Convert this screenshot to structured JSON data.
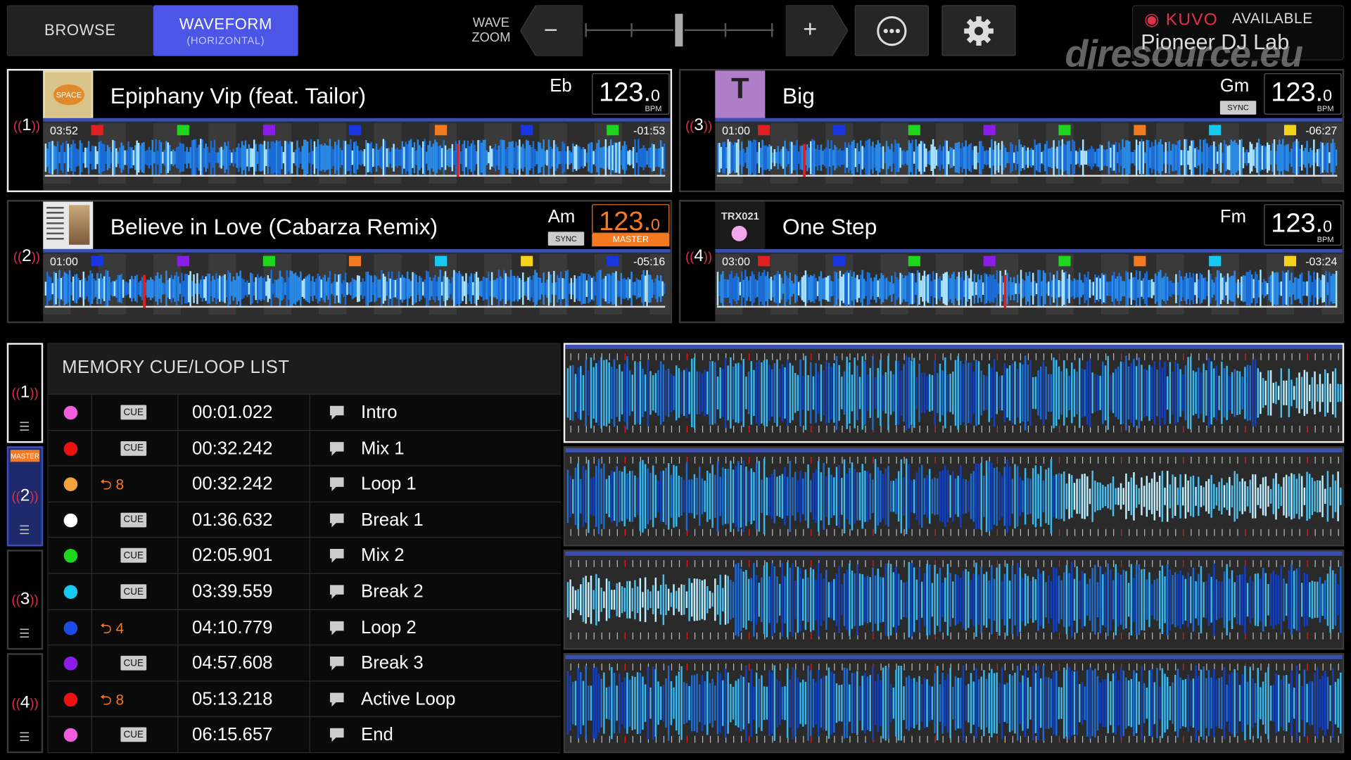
{
  "top_bar": {
    "browse_label": "BROWSE",
    "waveform_label": "WAVEFORM",
    "waveform_sub": "(HORIZONTAL)",
    "wave_zoom_line1": "WAVE",
    "wave_zoom_line2": "ZOOM",
    "zoom_out_symbol": "−",
    "zoom_in_symbol": "+",
    "zoom_level": 0.5,
    "more_icon": "more-icon",
    "settings_icon": "gear-icon"
  },
  "kuvo": {
    "logo": "KUVO",
    "status": "AVAILABLE",
    "name": "Pioneer DJ Lab"
  },
  "watermark": "djresource.eu",
  "decks": [
    {
      "number": "1",
      "title": "Epiphany Vip (feat. Tailor)",
      "key": "Eb",
      "bpm_int": "123.",
      "bpm_dec": "0",
      "bpm_unit": "BPM",
      "elapsed": "03:52",
      "remaining": "-01:53",
      "sync_label": "",
      "master_label": "",
      "active": true,
      "art_label": "SPACE",
      "hot_cues": [
        "A",
        "C",
        "D",
        "B",
        "F",
        "B",
        "E"
      ]
    },
    {
      "number": "2",
      "title": "Believe in Love (Cabarza Remix)",
      "key": "Am",
      "bpm_int": "123.",
      "bpm_dec": "0",
      "bpm_unit": "MASTER",
      "elapsed": "01:00",
      "remaining": "-05:16",
      "sync_label": "SYNC",
      "master_label": "MASTER",
      "active": false,
      "art_label": "",
      "hot_cues": [
        "B",
        "D",
        "E",
        "F",
        "G",
        "H",
        "B"
      ]
    },
    {
      "number": "3",
      "title": "Big",
      "key": "Gm",
      "bpm_int": "123.",
      "bpm_dec": "0",
      "bpm_unit": "BPM",
      "elapsed": "01:00",
      "remaining": "-06:27",
      "sync_label": "SYNC",
      "master_label": "",
      "active": false,
      "art_label": "T",
      "hot_cues": [
        "A",
        "B",
        "C",
        "D",
        "E",
        "F",
        "G",
        "H"
      ]
    },
    {
      "number": "4",
      "title": "One Step",
      "key": "Fm",
      "bpm_int": "123.",
      "bpm_dec": "0",
      "bpm_unit": "BPM",
      "elapsed": "03:00",
      "remaining": "-03:24",
      "sync_label": "",
      "master_label": "",
      "active": false,
      "art_label": "TRX021",
      "hot_cues": [
        "A",
        "B",
        "C",
        "D",
        "E",
        "F",
        "G",
        "H"
      ]
    }
  ],
  "memory_list": {
    "title": "MEMORY CUE/LOOP LIST",
    "side_master_label": "MASTER",
    "rows": [
      {
        "color": "#f25ce0",
        "type": "CUE",
        "loop_beats": "",
        "time": "00:01.022",
        "name": "Intro"
      },
      {
        "color": "#ee1111",
        "type": "CUE",
        "loop_beats": "",
        "time": "00:32.242",
        "name": "Mix 1"
      },
      {
        "color": "#f5a13a",
        "type": "LOOP",
        "loop_beats": "8",
        "time": "00:32.242",
        "name": "Loop 1"
      },
      {
        "color": "#ffffff",
        "type": "CUE",
        "loop_beats": "",
        "time": "01:36.632",
        "name": "Break 1"
      },
      {
        "color": "#1ed61e",
        "type": "CUE",
        "loop_beats": "",
        "time": "02:05.901",
        "name": "Mix 2"
      },
      {
        "color": "#18c8f0",
        "type": "CUE",
        "loop_beats": "",
        "time": "03:39.559",
        "name": "Break 2"
      },
      {
        "color": "#1a4ce8",
        "type": "LOOP",
        "loop_beats": "4",
        "time": "04:10.779",
        "name": "Loop 2"
      },
      {
        "color": "#8a1ee8",
        "type": "CUE",
        "loop_beats": "",
        "time": "04:57.608",
        "name": "Break 3"
      },
      {
        "color": "#ee1111",
        "type": "LOOP",
        "loop_beats": "8",
        "time": "05:13.218",
        "name": "Active Loop"
      },
      {
        "color": "#f25ce0",
        "type": "CUE",
        "loop_beats": "",
        "time": "06:15.657",
        "name": "End"
      }
    ]
  },
  "colors": {
    "accent": "#4c55e6",
    "master": "#f47a22",
    "cue_red": "#e0304a",
    "wave_blue": "#1a6cd8"
  }
}
